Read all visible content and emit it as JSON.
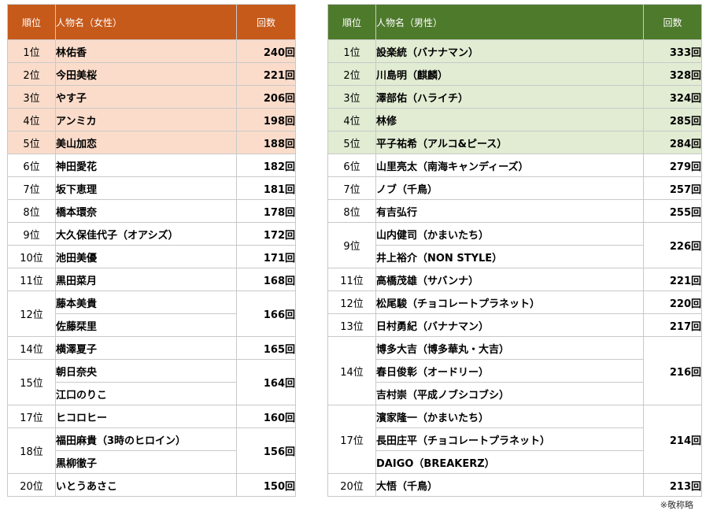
{
  "women": {
    "header": {
      "rank": "順位",
      "name": "人物名（女性）",
      "count": "回数"
    },
    "rows": [
      {
        "rank": "1位",
        "names": [
          "林佑香"
        ],
        "count": "240回",
        "top": true
      },
      {
        "rank": "2位",
        "names": [
          "今田美桜"
        ],
        "count": "221回",
        "top": true
      },
      {
        "rank": "3位",
        "names": [
          "やす子"
        ],
        "count": "206回",
        "top": true
      },
      {
        "rank": "4位",
        "names": [
          "アンミカ"
        ],
        "count": "198回",
        "top": true
      },
      {
        "rank": "5位",
        "names": [
          "美山加恋"
        ],
        "count": "188回",
        "top": true
      },
      {
        "rank": "6位",
        "names": [
          "神田愛花"
        ],
        "count": "182回"
      },
      {
        "rank": "7位",
        "names": [
          "坂下恵理"
        ],
        "count": "181回"
      },
      {
        "rank": "8位",
        "names": [
          "橋本環奈"
        ],
        "count": "178回"
      },
      {
        "rank": "9位",
        "names": [
          "大久保佳代子（オアシズ）"
        ],
        "count": "172回"
      },
      {
        "rank": "10位",
        "names": [
          "池田美優"
        ],
        "count": "171回"
      },
      {
        "rank": "11位",
        "names": [
          "黒田菜月"
        ],
        "count": "168回"
      },
      {
        "rank": "12位",
        "names": [
          "藤本美貴",
          "佐藤栞里"
        ],
        "count": "166回"
      },
      {
        "rank": "14位",
        "names": [
          "横澤夏子"
        ],
        "count": "165回"
      },
      {
        "rank": "15位",
        "names": [
          "朝日奈央",
          "江口のりこ"
        ],
        "count": "164回"
      },
      {
        "rank": "17位",
        "names": [
          "ヒコロヒー"
        ],
        "count": "160回"
      },
      {
        "rank": "18位",
        "names": [
          "福田麻貴（3時のヒロイン）",
          "黒柳徹子"
        ],
        "count": "156回"
      },
      {
        "rank": "20位",
        "names": [
          "いとうあさこ"
        ],
        "count": "150回"
      }
    ]
  },
  "men": {
    "header": {
      "rank": "順位",
      "name": "人物名（男性）",
      "count": "回数"
    },
    "rows": [
      {
        "rank": "1位",
        "names": [
          "設楽統（バナナマン）"
        ],
        "count": "333回",
        "top": true
      },
      {
        "rank": "2位",
        "names": [
          "川島明（麒麟）"
        ],
        "count": "328回",
        "top": true
      },
      {
        "rank": "3位",
        "names": [
          "澤部佑（ハライチ）"
        ],
        "count": "324回",
        "top": true
      },
      {
        "rank": "4位",
        "names": [
          "林修"
        ],
        "count": "285回",
        "top": true
      },
      {
        "rank": "5位",
        "names": [
          "平子祐希（アルコ&ピース）"
        ],
        "count": "284回",
        "top": true
      },
      {
        "rank": "6位",
        "names": [
          "山里亮太（南海キャンディーズ）"
        ],
        "count": "279回"
      },
      {
        "rank": "7位",
        "names": [
          "ノブ（千鳥）"
        ],
        "count": "257回"
      },
      {
        "rank": "8位",
        "names": [
          "有吉弘行"
        ],
        "count": "255回"
      },
      {
        "rank": "9位",
        "names": [
          "山内健司（かまいたち）",
          "井上裕介（NON STYLE）"
        ],
        "count": "226回"
      },
      {
        "rank": "11位",
        "names": [
          "高橋茂雄（サバンナ）"
        ],
        "count": "221回"
      },
      {
        "rank": "12位",
        "names": [
          "松尾駿（チョコレートプラネット）"
        ],
        "count": "220回"
      },
      {
        "rank": "13位",
        "names": [
          "日村勇紀（バナナマン）"
        ],
        "count": "217回"
      },
      {
        "rank": "14位",
        "names": [
          "博多大吉（博多華丸・大吉）",
          "春日俊彰（オードリー）",
          "吉村崇（平成ノブシコブシ）"
        ],
        "count": "216回"
      },
      {
        "rank": "17位",
        "names": [
          "濱家隆一（かまいたち）",
          "長田庄平（チョコレートプラネット）",
          "DAIGO（BREAKERZ）"
        ],
        "count": "214回"
      },
      {
        "rank": "20位",
        "names": [
          "大悟（千鳥）"
        ],
        "count": "213回"
      }
    ]
  },
  "note": "※敬称略",
  "colors": {
    "women_header": "#c65a1a",
    "women_highlight": "#fbdccb",
    "men_header": "#4e7a2c",
    "men_highlight": "#e1ecd3",
    "border": "#c9c9c9"
  }
}
